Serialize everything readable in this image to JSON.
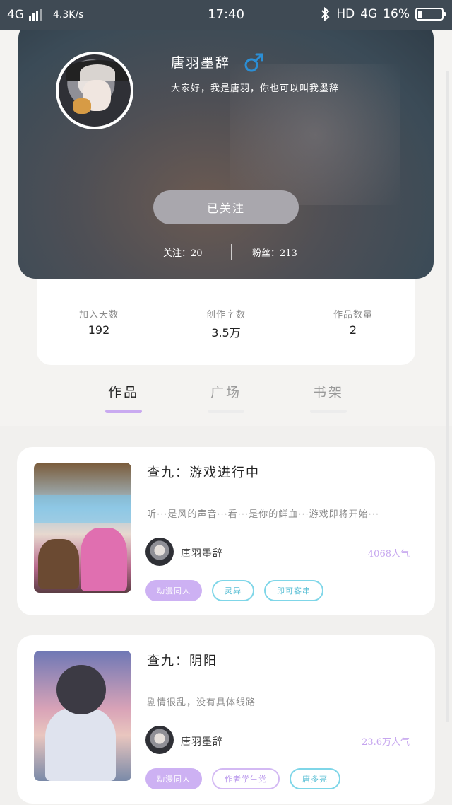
{
  "status_bar": {
    "network": "4G",
    "speed": "4.3K/s",
    "time": "17:40",
    "hd": "HD",
    "network_right": "4G",
    "battery": "16%"
  },
  "profile": {
    "name": "唐羽墨辞",
    "gender_icon": "male-icon",
    "bio": "大家好，我是唐羽，你也可以叫我墨辞",
    "follow_button": "已关注",
    "following": "关注：20",
    "followers": "粉丝：213"
  },
  "stats": [
    {
      "label": "加入天数",
      "value": "192"
    },
    {
      "label": "创作字数",
      "value": "3.5万"
    },
    {
      "label": "作品数量",
      "value": "2"
    }
  ],
  "tabs": [
    {
      "label": "作品",
      "active": true
    },
    {
      "label": "广场",
      "active": false
    },
    {
      "label": "书架",
      "active": false
    }
  ],
  "works": [
    {
      "title": "查九：游戏进行中",
      "desc": "听···是风的声音···看···是你的鲜血···游戏即将开始···",
      "author": "唐羽墨辞",
      "popularity": "4068人气",
      "tags": [
        "动漫同人",
        "灵异",
        "即可客串"
      ]
    },
    {
      "title": "查九：阴阳",
      "desc": "剧情很乱，没有具体线路",
      "author": "唐羽墨辞",
      "popularity": "23.6万人气",
      "tags": [
        "动漫同人",
        "作者学生党",
        "唐多亮"
      ]
    }
  ],
  "colors": {
    "accent": "#c9aaf0",
    "cyan": "#7fd6e8",
    "male": "#2b8fd6"
  }
}
